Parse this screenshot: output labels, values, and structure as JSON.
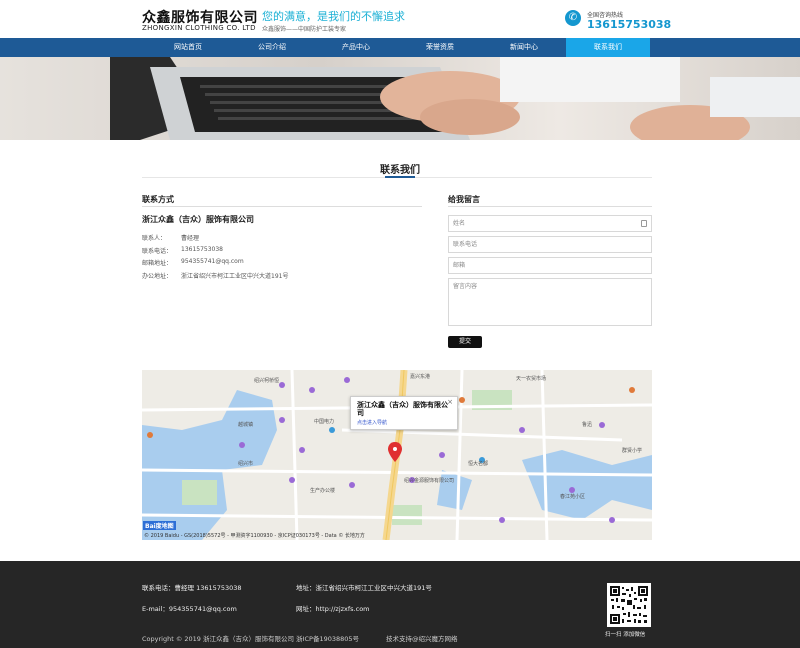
{
  "header": {
    "logo_cn": "众鑫服饰有限公司",
    "logo_en": "ZHONGXIN CLOTHING CO. LTD",
    "slogan": "您的满意，是我们的不懈追求",
    "subslogan": "众鑫服饰——中国防护工装专家",
    "hotline_label": "全国咨询热线",
    "hotline_phone": "13615753038"
  },
  "nav": {
    "items": [
      {
        "label": "网站首页"
      },
      {
        "label": "公司介绍"
      },
      {
        "label": "产品中心"
      },
      {
        "label": "荣誉资质"
      },
      {
        "label": "新闻中心"
      },
      {
        "label": "联系我们"
      }
    ],
    "active_index": 5
  },
  "page": {
    "title": "联系我们"
  },
  "contact": {
    "heading": "联系方式",
    "company": "浙江众鑫（吉众）服饰有限公司",
    "rows": [
      {
        "label": "联系人：",
        "value": "曹经理"
      },
      {
        "label": "联系电话：",
        "value": "13615753038"
      },
      {
        "label": "邮箱地址：",
        "value": "954355741@qq.com"
      },
      {
        "label": "办公地址：",
        "value": "浙江省绍兴市柯江工业区中兴大道191号"
      }
    ]
  },
  "form": {
    "heading": "给我留言",
    "name_placeholder": "姓名",
    "phone_placeholder": "联系电话",
    "email_placeholder": "邮箱",
    "message_placeholder": "留言内容",
    "submit_label": "提交"
  },
  "map": {
    "popup_title": "浙江众鑫（吉众）服饰有限公司",
    "popup_link": "点击进入导航",
    "popup_close": "×",
    "baidu_logo": "Bai度地图",
    "copyright": "© 2019 Baidu - GS(2018)5572号 - 甲测资字1100930 - 京ICP证030173号 - Data © 长地万方",
    "labels": [
      "绍兴柯桥恒",
      "嘉兴东港",
      "中国电力",
      "越城镇",
      "绍兴市",
      "天一农贸市场",
      "恒大名都",
      "生产办公楼",
      "绍兴金源服饰有限公司",
      "鲁迅",
      "春江苑小区",
      "群贤小学"
    ]
  },
  "footer": {
    "phone": "联系电话：曹经理 13615753038",
    "address": "地址：浙江省绍兴市柯江工业区中兴大道191号",
    "email": "E-mail：954355741@qq.com",
    "website": "网址：http://zjzxfs.com",
    "copyright": "Copyright © 2019 浙江众鑫（吉众）服饰有限公司 浙ICP备19038805号",
    "support": "技术支持@绍兴魔方网络",
    "qr_caption": "扫一扫 添加微信"
  },
  "colors": {
    "nav_bg": "#1e5a96",
    "nav_active": "#1aa6e8",
    "accent": "#1497cf",
    "footer_bg": "#262626"
  }
}
